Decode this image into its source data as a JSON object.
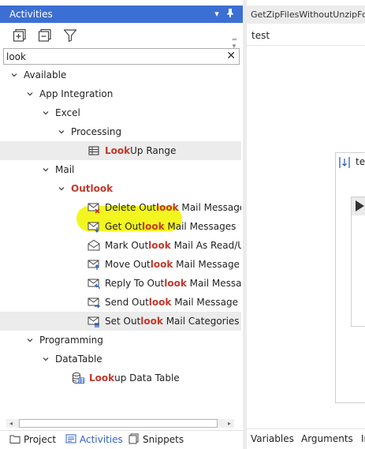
{
  "panel": {
    "title": "Activities",
    "pin_glyph": "⎕",
    "close_glyph": "✕",
    "dropdown_glyph": "▾"
  },
  "search": {
    "value": "look",
    "clear_glyph": "✕"
  },
  "tree": {
    "available": "Available",
    "app_integration": "App Integration",
    "excel": "Excel",
    "processing": "Processing",
    "lookup_range": {
      "hl": "Look",
      "rest": "Up Range"
    },
    "mail": "Mail",
    "outlook": {
      "pre": "Out",
      "hl": "look"
    },
    "mail_items": [
      {
        "pre": "Delete Out",
        "hl": "look",
        "post": " Mail Message"
      },
      {
        "pre": "Get Out",
        "hl": "look",
        "post": " Mail Messages"
      },
      {
        "pre": "Mark Out",
        "hl": "look",
        "post": " Mail As Read/Unre"
      },
      {
        "pre": "Move Out",
        "hl": "look",
        "post": " Mail Message"
      },
      {
        "pre": "Reply To Out",
        "hl": "look",
        "post": " Mail Message"
      },
      {
        "pre": "Send Out",
        "hl": "look",
        "post": " Mail Message"
      },
      {
        "pre": "Set Out",
        "hl": "look",
        "post": " Mail Categories"
      }
    ],
    "programming": "Programming",
    "datatable": "DataTable",
    "lookup_datatable": {
      "hl": "Look",
      "rest": "up Data Table"
    }
  },
  "tabs": [
    "Project",
    "Activities",
    "Snippets"
  ],
  "designer": {
    "doc_tab": "GetZipFilesWithoutUnzipFo",
    "breadcrumb": "test",
    "sequence_label": "tes",
    "bottom_tabs": [
      "Variables",
      "Arguments",
      "In"
    ]
  },
  "colors": {
    "title_bar": "#3c6fd3",
    "match_highlight": "#c0392b",
    "marker": "#f2f50b",
    "active_tab": "#2f5fc6"
  }
}
